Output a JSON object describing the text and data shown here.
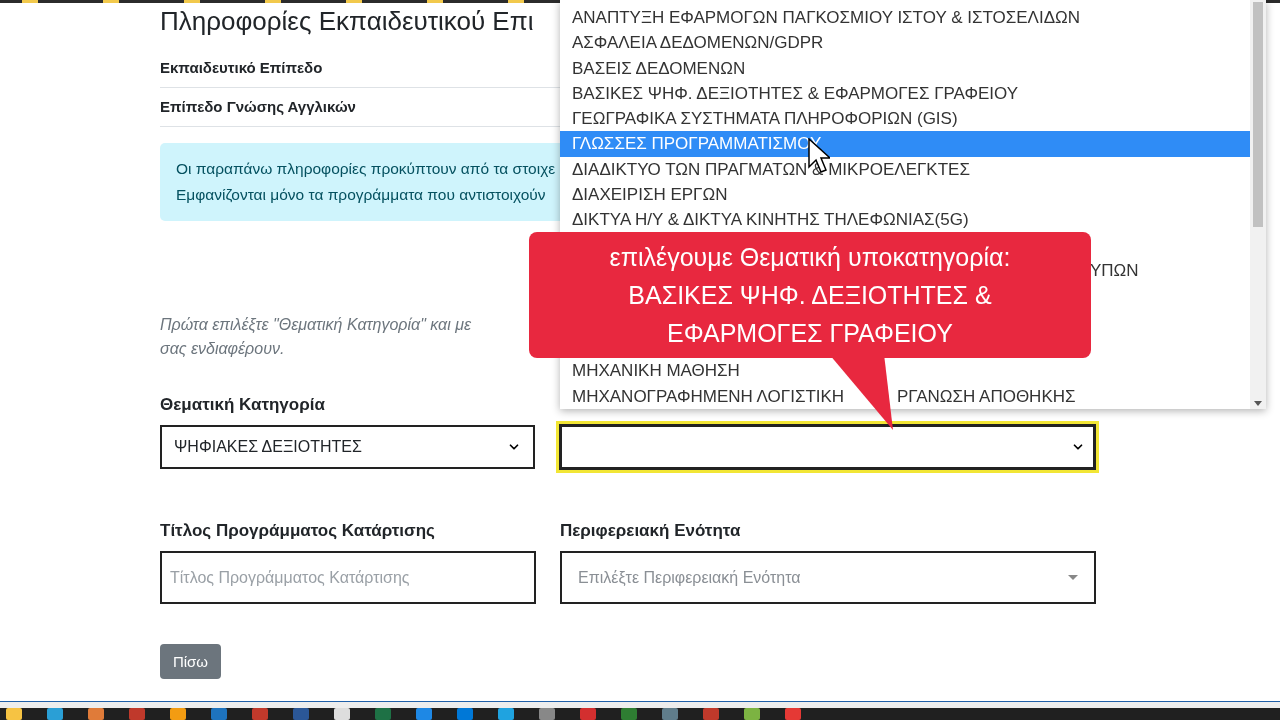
{
  "page": {
    "heading": "Πληροφορίες Εκπαιδευτικού Επι",
    "details": [
      {
        "label": "Εκπαιδευτικό Επίπεδο"
      },
      {
        "label": "Επίπεδο Γνώσης Αγγλικών"
      }
    ],
    "info_lines": [
      "Οι παραπάνω πληροφορίες προκύπτουν από τα στοιχε",
      "Εμφανίζονται μόνο τα προγράμματα που αντιστοιχούν"
    ],
    "hint_lines": [
      "Πρώτα επιλέξτε \"Θεματική Κατηγορία\" και με",
      "σας ενδιαφέρουν."
    ],
    "category": {
      "label": "Θεματική Κατηγορία",
      "value": "ΨΗΦΙΑΚΕΣ ΔΕΞΙΟΤΗΤΕΣ"
    },
    "subcategory": {
      "focused": true
    },
    "title_field": {
      "label": "Τίτλος Προγράμματος Κατάρτισης",
      "placeholder": "Τίτλος Προγράμματος Κατάρτισης"
    },
    "region_field": {
      "label": "Περιφερειακή Ενότητα",
      "placeholder": "Επιλέξτε Περιφερειακή Ενότητα"
    },
    "back_button": "Πίσω"
  },
  "dropdown": {
    "options": [
      {
        "label": "ΑΝΑΠΤΥΞΗ ΕΦΑΡΜΟΓΩΝ ΠΑΓΚΟΣΜΙΟΥ ΙΣΤΟΥ & ΙΣΤΟΣΕΛΙΔΩΝ",
        "selected": false,
        "kind": "full"
      },
      {
        "label": "ΑΣΦΑΛΕΙΑ ΔΕΔΟΜΕΝΩΝ/GDPR",
        "selected": false,
        "kind": "full"
      },
      {
        "label": "ΒΑΣΕΙΣ ΔΕΔΟΜΕΝΩΝ",
        "selected": false,
        "kind": "full"
      },
      {
        "label": "ΒΑΣΙΚΕΣ ΨΗΦ. ΔΕΞΙΟΤΗΤΕΣ & ΕΦΑΡΜΟΓΕΣ ΓΡΑΦΕΙΟΥ",
        "selected": false,
        "kind": "full"
      },
      {
        "label": "ΓΕΩΓΡΑΦΙΚΑ ΣΥΣΤΗΜΑΤΑ ΠΛΗΡΟΦΟΡΙΩΝ (GIS)",
        "selected": false,
        "kind": "full"
      },
      {
        "label": "ΓΛΩΣΣΕΣ ΠΡΟΓΡΑΜΜΑΤΙΣΜΟΥ",
        "selected": true,
        "kind": "full"
      },
      {
        "label": "ΔΙΑΔΙΚΤΥΟ ΤΩΝ ΠΡΑΓΜΑΤΩΝ & ΜΙΚΡΟΕΛΕΓΚΤΕΣ",
        "selected": false,
        "kind": "full"
      },
      {
        "label": "ΔΙΑΧΕΙΡΙΣΗ ΕΡΓΩΝ",
        "selected": false,
        "kind": "full"
      },
      {
        "label": "ΔΙΚΤΥΑ Η/Υ & ΔΙΚΤΥΑ ΚΙΝΗΤΗΣ ΤΗΛΕΦΩΝΙΑΣ(5G)",
        "selected": false,
        "kind": "full"
      },
      {
        "label": "ΥΠΩΝ",
        "selected": false,
        "kind": "covered"
      },
      {
        "label": "ΜΗΧΑΝΙΚΗ ΜΑΘΗΣΗ",
        "selected": false,
        "kind": "full"
      },
      {
        "parts": [
          "ΜΗΧΑΝΟΓΡΑΦΗΜΕΝΗ ΛΟΓΙΣΤΙΚΗ",
          "ΡΓΑΝΩΣΗ ΑΠΟΘΗΚΗΣ"
        ],
        "selected": false,
        "kind": "split"
      }
    ]
  },
  "callout": {
    "lines": [
      "επιλέγουμε Θεματική υποκατηγορία:",
      "ΒΑΣΙΚΕΣ ΨΗΦ. ΔΕΞΙΟΤΗΤΕΣ &",
      "ΕΦΑΡΜΟΓΕΣ ΓΡΑΦΕΙΟΥ"
    ]
  }
}
